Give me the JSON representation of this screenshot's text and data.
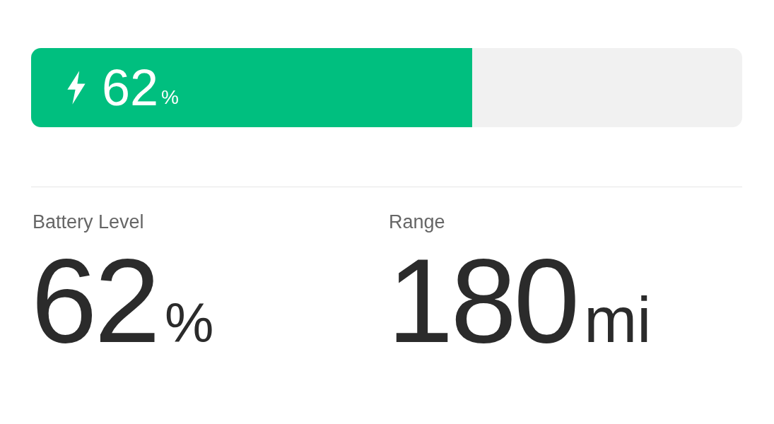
{
  "battery_bar": {
    "level": 0.62,
    "charging": true,
    "value": "62",
    "unit": "%"
  },
  "stats": [
    {
      "label": "Battery Level",
      "value": "62",
      "unit": "%"
    },
    {
      "label": "Range",
      "value": "180",
      "unit": "mi"
    }
  ]
}
